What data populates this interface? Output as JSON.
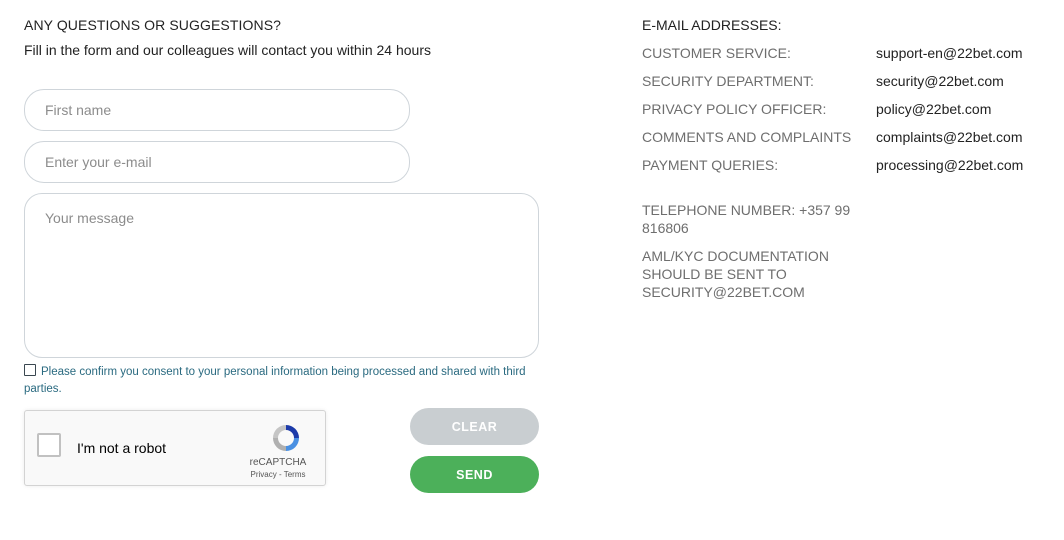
{
  "form": {
    "heading": "ANY QUESTIONS OR SUGGESTIONS?",
    "subheading": "Fill in the form and our colleagues will contact you within 24 hours",
    "first_name_placeholder": "First name",
    "email_placeholder": "Enter your e-mail",
    "message_placeholder": "Your message",
    "consent_text": "Please confirm you consent to your personal information being processed and shared with third parties.",
    "clear_label": "CLEAR",
    "send_label": "SEND"
  },
  "captcha": {
    "label": "I'm not a robot",
    "brand": "reCAPTCHA",
    "terms": "Privacy - Terms"
  },
  "contacts": {
    "title": "E-MAIL ADDRESSES:",
    "rows": [
      {
        "label": "CUSTOMER SERVICE:",
        "value": "support-en@22bet.com"
      },
      {
        "label": "SECURITY DEPARTMENT:",
        "value": "security@22bet.com"
      },
      {
        "label": "PRIVACY POLICY OFFICER:",
        "value": "policy@22bet.com"
      },
      {
        "label": "COMMENTS AND COMPLAINTS",
        "value": "complaints@22bet.com"
      },
      {
        "label": "PAYMENT QUERIES:",
        "value": "processing@22bet.com"
      }
    ],
    "telephone": "TELEPHONE NUMBER: +357 99 816806",
    "aml_note": "AML/KYC DOCUMENTATION SHOULD BE SENT TO SECURITY@22BET.COM"
  },
  "colors": {
    "send_button": "#4cb05a",
    "clear_button": "#c9ced1",
    "consent_link": "#2a6a80"
  }
}
